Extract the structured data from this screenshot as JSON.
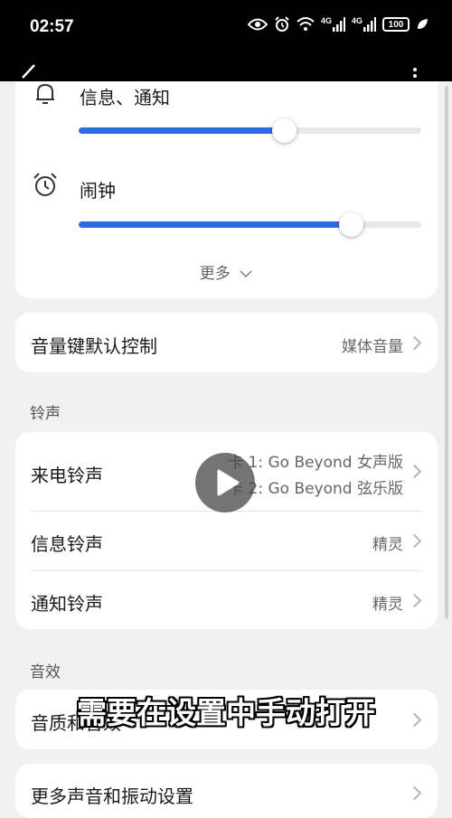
{
  "status_bar": {
    "time": "02:57",
    "net1": "4G",
    "net2": "4G",
    "battery": "100"
  },
  "volume": {
    "items": [
      {
        "label": "信息、通知",
        "level": 0.6,
        "icon": "bell-icon"
      },
      {
        "label": "闹钟",
        "level": 0.795,
        "icon": "alarm-clock-icon"
      }
    ],
    "more_label": "更多"
  },
  "volume_key": {
    "label": "音量键默认控制",
    "value": "媒体音量"
  },
  "ringtone_section": {
    "title": "铃声",
    "incoming": {
      "label": "来电铃声",
      "value_line1": "卡 1: Go Beyond 女声版",
      "value_line2": "卡 2: Go Beyond 弦乐版"
    },
    "message": {
      "label": "信息铃声",
      "value": "精灵"
    },
    "notification": {
      "label": "通知铃声",
      "value": "精灵"
    }
  },
  "sound_effect_section": {
    "title": "音效",
    "quality": {
      "label": "音质和音效"
    }
  },
  "more_settings": {
    "label": "更多声音和振动设置"
  },
  "subtitle": "需要在设置中手动打开",
  "colors": {
    "accent": "#2d6ae8",
    "background": "#f1f1f1",
    "card": "#ffffff"
  }
}
